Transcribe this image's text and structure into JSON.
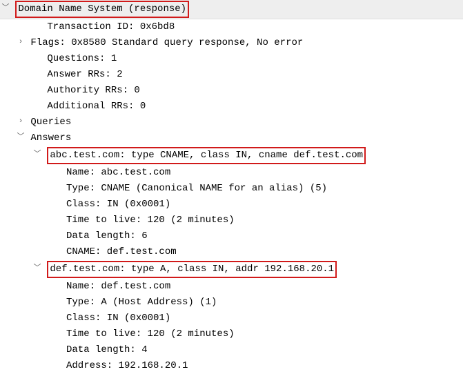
{
  "protocol_header": "Domain Name System (response)",
  "transaction_id": "Transaction ID: 0x6bd8",
  "flags": "Flags: 0x8580 Standard query response, No error",
  "questions": "Questions: 1",
  "answer_rrs": "Answer RRs: 2",
  "authority_rrs": "Authority RRs: 0",
  "additional_rrs": "Additional RRs: 0",
  "queries_label": "Queries",
  "answers_label": "Answers",
  "answer1": {
    "summary": "abc.test.com: type CNAME, class IN, cname def.test.com",
    "name": "Name: abc.test.com",
    "type": "Type: CNAME (Canonical NAME for an alias) (5)",
    "class": "Class: IN (0x0001)",
    "ttl": "Time to live: 120 (2 minutes)",
    "data_length": "Data length: 6",
    "cname": "CNAME: def.test.com"
  },
  "answer2": {
    "summary": "def.test.com: type A, class IN, addr 192.168.20.1",
    "name": "Name: def.test.com",
    "type": "Type: A (Host Address) (1)",
    "class": "Class: IN (0x0001)",
    "ttl": "Time to live: 120 (2 minutes)",
    "data_length": "Data length: 4",
    "address": "Address: 192.168.20.1"
  }
}
